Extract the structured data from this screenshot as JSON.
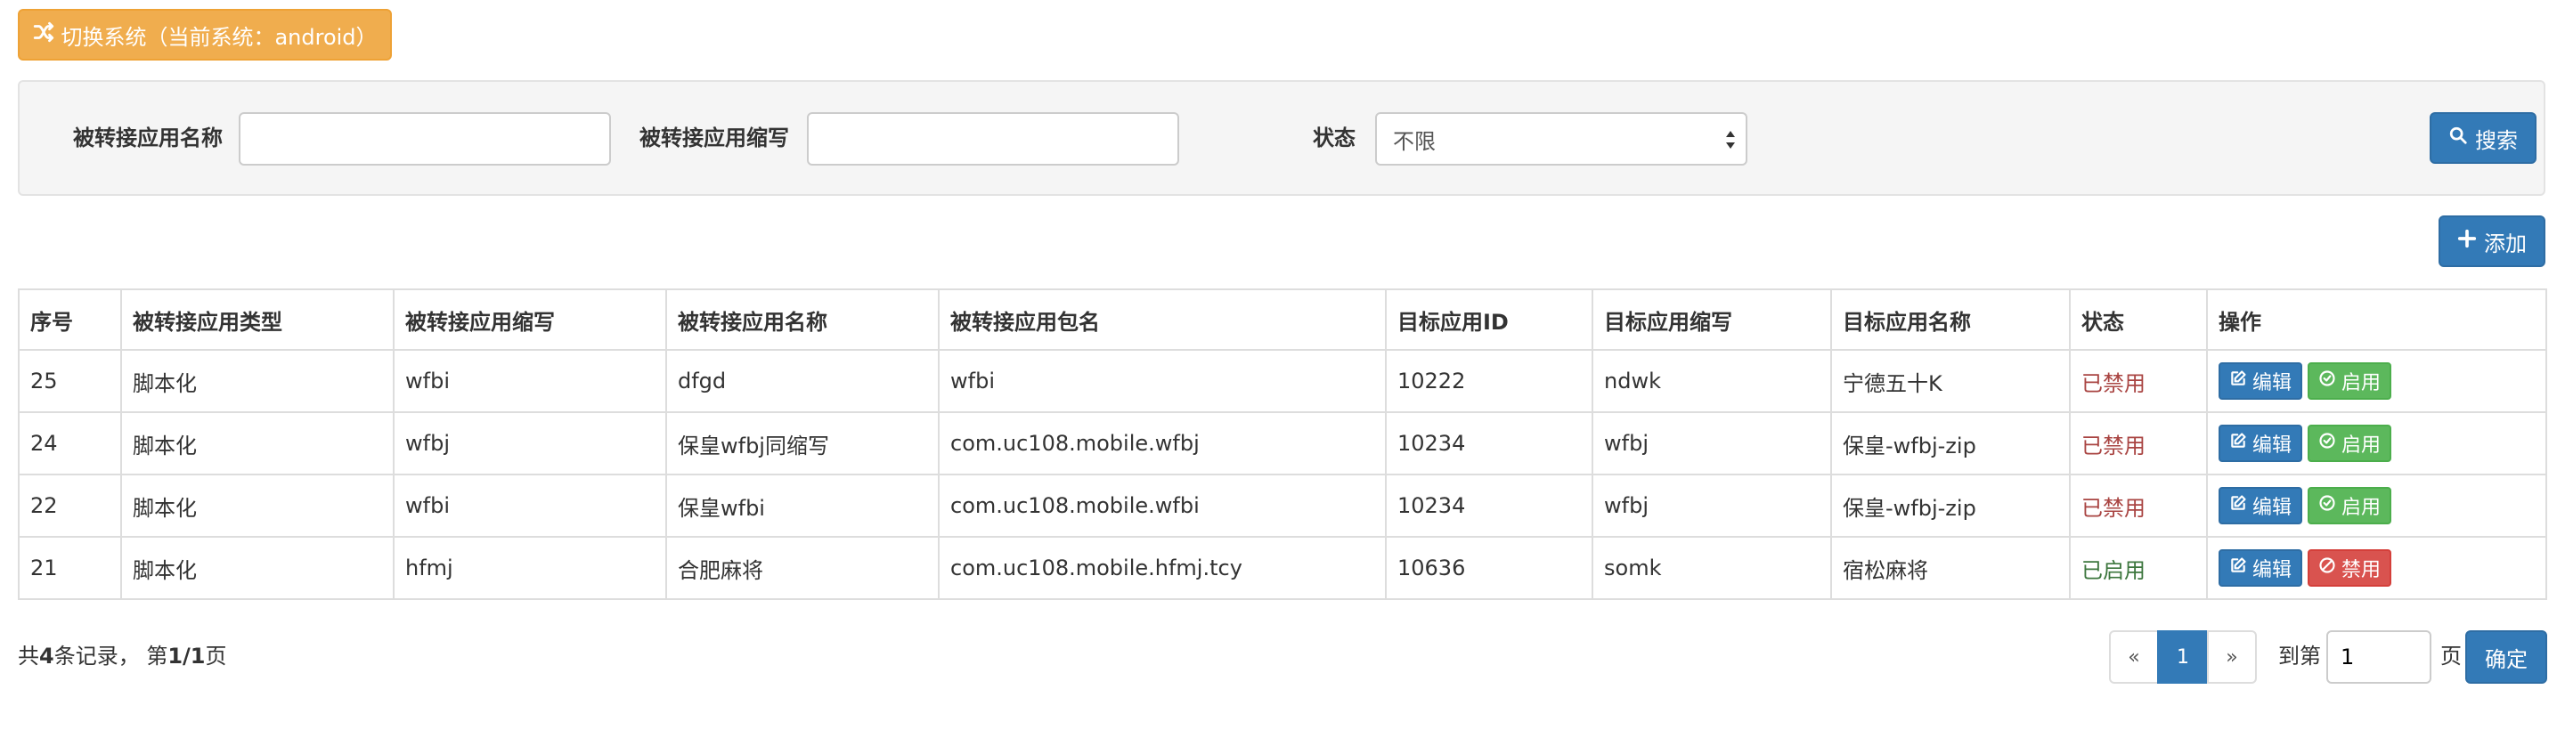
{
  "switch_button": {
    "label": "切换系统（当前系统：android）"
  },
  "search": {
    "name_label": "被转接应用名称",
    "name_value": "",
    "abbr_label": "被转接应用缩写",
    "abbr_value": "",
    "status_label": "状态",
    "status_selected": "不限",
    "search_button": "搜索"
  },
  "add_button": "添加",
  "table": {
    "columns": [
      "序号",
      "被转接应用类型",
      "被转接应用缩写",
      "被转接应用名称",
      "被转接应用包名",
      "目标应用ID",
      "目标应用缩写",
      "目标应用名称",
      "状态",
      "操作"
    ],
    "rows": [
      {
        "id": "25",
        "type": "脚本化",
        "abbr": "wfbi",
        "name": "dfgd",
        "package": "wfbi",
        "target_id": "10222",
        "target_abbr": "ndwk",
        "target_name": "宁德五十K",
        "status": "已禁用",
        "edit": "编辑",
        "toggle": "启用"
      },
      {
        "id": "24",
        "type": "脚本化",
        "abbr": "wfbj",
        "name": "保皇wfbj同缩写",
        "package": "com.uc108.mobile.wfbj",
        "target_id": "10234",
        "target_abbr": "wfbj",
        "target_name": "保皇-wfbj-zip",
        "status": "已禁用",
        "edit": "编辑",
        "toggle": "启用"
      },
      {
        "id": "22",
        "type": "脚本化",
        "abbr": "wfbi",
        "name": "保皇wfbi",
        "package": "com.uc108.mobile.wfbi",
        "target_id": "10234",
        "target_abbr": "wfbj",
        "target_name": "保皇-wfbj-zip",
        "status": "已禁用",
        "edit": "编辑",
        "toggle": "启用"
      },
      {
        "id": "21",
        "type": "脚本化",
        "abbr": "hfmj",
        "name": "合肥麻将",
        "package": "com.uc108.mobile.hfmj.tcy",
        "target_id": "10636",
        "target_abbr": "somk",
        "target_name": "宿松麻将",
        "status": "已启用",
        "edit": "编辑",
        "toggle": "禁用"
      }
    ]
  },
  "footer": {
    "total_prefix": "共",
    "total_count": "4",
    "total_suffix": "条记录，  第",
    "page_fraction": "1/1",
    "page_suffix": "页",
    "prev": "«",
    "current_page": "1",
    "next": "»",
    "goto_prefix": "到第",
    "goto_value": "1",
    "goto_suffix": "页",
    "confirm": "确定"
  },
  "colors": {
    "warning": "#f0ad4e",
    "primary": "#337ab7",
    "success": "#5cb85c",
    "danger": "#d9534f",
    "status_disabled": "#a94442",
    "status_enabled": "#3c763d"
  },
  "icons": {
    "switch": "random-icon",
    "search": "search-icon",
    "add": "plus-icon",
    "edit": "edit-icon",
    "enable": "check-circle-icon",
    "disable": "ban-icon"
  }
}
